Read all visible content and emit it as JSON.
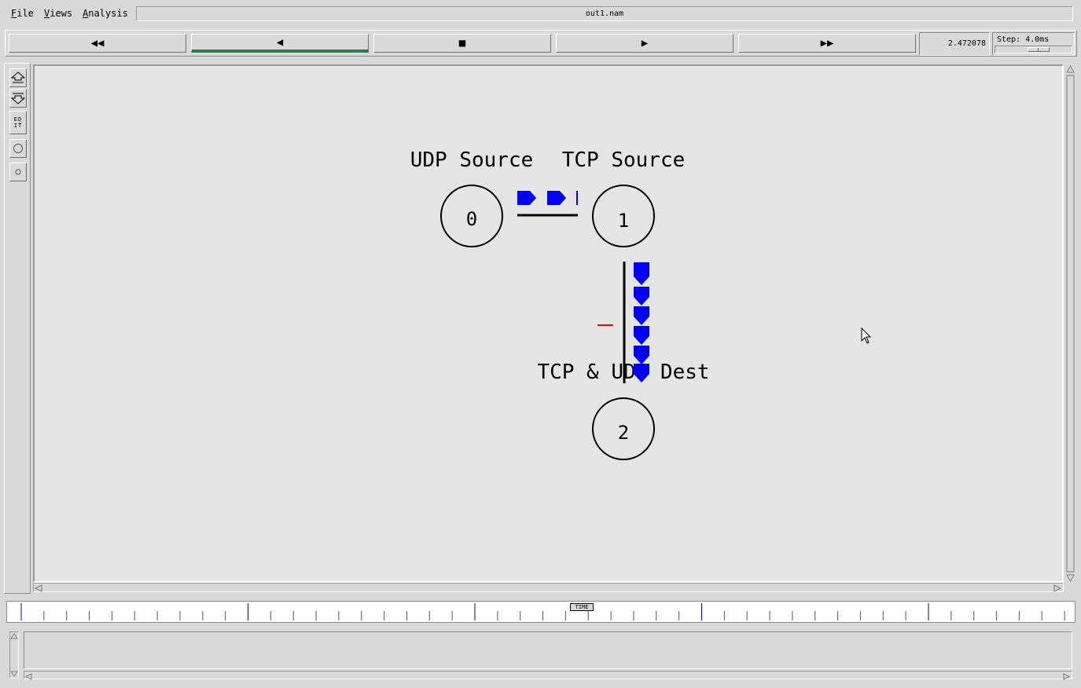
{
  "menu": {
    "file": {
      "accel": "F",
      "rest": "ile"
    },
    "views": {
      "accel": "V",
      "rest": "iews"
    },
    "analysis": {
      "accel": "A",
      "rest": "nalysis"
    }
  },
  "window": {
    "title": "out1.nam"
  },
  "toolbar": {
    "buttons": [
      "◀◀",
      "◀",
      "■",
      "▶",
      "▶▶"
    ],
    "time": "2.472078",
    "step_label": "Step: 4.0ms"
  },
  "left_tools": {
    "edit_label_top": "ED",
    "edit_label_bottom": "IT"
  },
  "nodes": [
    {
      "id": "0",
      "label": "UDP Source"
    },
    {
      "id": "1",
      "label": "TCP Source"
    },
    {
      "id": "2",
      "label": "TCP & UDP Dest"
    }
  ],
  "timeline": {
    "marker_label": "TIME"
  },
  "colors": {
    "packet": "#0000ff",
    "drop": "#ff0000",
    "canvas_bg": "#e5e5e5",
    "active_button": "#2e7d4f"
  }
}
